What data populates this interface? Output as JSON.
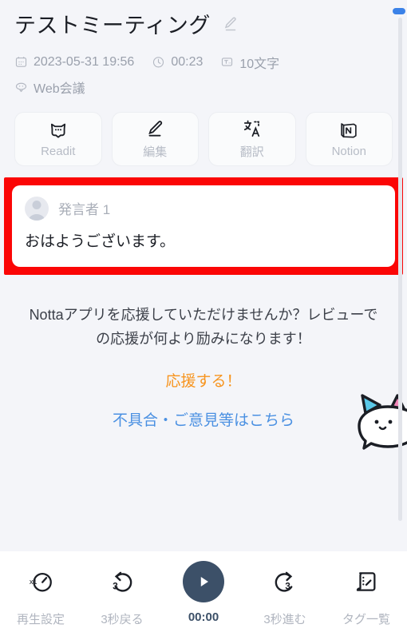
{
  "header": {
    "title": "テストミーティング",
    "edit_icon": "pencil-edit-icon",
    "meta": [
      {
        "icon": "calendar-icon",
        "text": "2023-05-31 19:56"
      },
      {
        "icon": "clock-icon",
        "text": "00:23"
      },
      {
        "icon": "text-count-icon",
        "text": "10文字"
      },
      {
        "icon": "web-meeting-icon",
        "text": "Web会議"
      }
    ]
  },
  "actions": [
    {
      "icon": "cat-face-icon",
      "label": "Readit"
    },
    {
      "icon": "pencil-edit-icon",
      "label": "編集"
    },
    {
      "icon": "translate-icon",
      "label": "翻訳"
    },
    {
      "icon": "notion-icon",
      "label": "Notion"
    }
  ],
  "transcript": {
    "highlight_color": "#fb0606",
    "speaker_avatar": "user-avatar-icon",
    "speaker": "発言者 1",
    "text": "おはようございます。"
  },
  "promo": {
    "message": "Nottaアプリを応援していただけませんか？レビューでの応援が何より励みになります！",
    "cta_label": "応援する！",
    "cta_color": "#f7941e",
    "link_label": "不具合・ご意見等はこちら",
    "link_color": "#4a90e2",
    "mascot": "cat-mascot-illustration"
  },
  "scrollbar": {
    "thumb_color": "#3b82e8",
    "track_color": "#e2e4ea"
  },
  "toolbar": [
    {
      "icon": "playback-speed-icon",
      "label": "再生設定"
    },
    {
      "icon": "rewind-3s-icon",
      "label": "3秒戻る"
    },
    {
      "icon": "play-icon",
      "label": "00:00"
    },
    {
      "icon": "forward-3s-icon",
      "label": "3秒進む"
    },
    {
      "icon": "tag-list-icon",
      "label": "タグ一覧"
    }
  ],
  "colors": {
    "background": "#f4f5f9",
    "card": "#ffffff",
    "play_button": "#3c5068"
  }
}
